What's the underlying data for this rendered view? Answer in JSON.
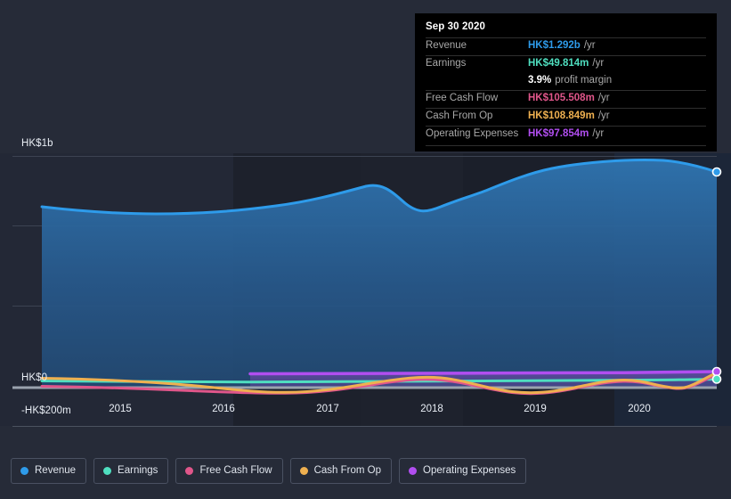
{
  "chart_data": {
    "type": "area",
    "title": "",
    "xlabel": "",
    "ylabel": "",
    "currency": "HK$",
    "grid": true,
    "legend_position": "bottom-left",
    "ylim": [
      -200000000,
      1100000000
    ],
    "y_ticks": [
      {
        "label": "HK$1b",
        "value": 1000000000
      },
      {
        "label": "HK$0",
        "value": 0
      },
      {
        "label": "-HK$200m",
        "value": -200000000
      }
    ],
    "x_ticks": [
      "2015",
      "2016",
      "2017",
      "2018",
      "2019",
      "2020"
    ],
    "xlim": [
      "2014-06",
      "2020-12"
    ],
    "series": [
      {
        "name": "Revenue",
        "color": "#2e9bea",
        "fill": true,
        "values": [
          {
            "x": "2014-09",
            "y": 740
          },
          {
            "x": "2015-03",
            "y": 716
          },
          {
            "x": "2015-09",
            "y": 706
          },
          {
            "x": "2016-03",
            "y": 708
          },
          {
            "x": "2016-09",
            "y": 730
          },
          {
            "x": "2017-03",
            "y": 776
          },
          {
            "x": "2017-06",
            "y": 794
          },
          {
            "x": "2017-12",
            "y": 712
          },
          {
            "x": "2018-06",
            "y": 760
          },
          {
            "x": "2018-12",
            "y": 880
          },
          {
            "x": "2019-06",
            "y": 962
          },
          {
            "x": "2019-12",
            "y": 1060
          },
          {
            "x": "2020-03",
            "y": 1115
          },
          {
            "x": "2020-09",
            "y": 1292
          }
        ]
      },
      {
        "name": "Earnings",
        "color": "#4fdfc0",
        "fill": false,
        "values": [
          {
            "x": "2014-09",
            "y": -13
          },
          {
            "x": "2015-09",
            "y": -14
          },
          {
            "x": "2016-09",
            "y": -12
          },
          {
            "x": "2017-09",
            "y": -10
          },
          {
            "x": "2018-09",
            "y": -8
          },
          {
            "x": "2019-09",
            "y": -6
          },
          {
            "x": "2020-09",
            "y": 49.814
          }
        ]
      },
      {
        "name": "Free Cash Flow",
        "color": "#e0568a",
        "fill": false,
        "values": [
          {
            "x": "2014-09",
            "y": -4
          },
          {
            "x": "2015-09",
            "y": -18
          },
          {
            "x": "2016-09",
            "y": -42
          },
          {
            "x": "2017-06",
            "y": -12
          },
          {
            "x": "2018-03",
            "y": -50
          },
          {
            "x": "2019-03",
            "y": -4
          },
          {
            "x": "2019-12",
            "y": -30
          },
          {
            "x": "2020-09",
            "y": 105.508
          }
        ]
      },
      {
        "name": "Cash From Op",
        "color": "#efb050",
        "fill": false,
        "values": [
          {
            "x": "2014-09",
            "y": 4
          },
          {
            "x": "2015-09",
            "y": -14
          },
          {
            "x": "2016-09",
            "y": -40
          },
          {
            "x": "2017-06",
            "y": -10
          },
          {
            "x": "2018-03",
            "y": -48
          },
          {
            "x": "2019-03",
            "y": -2
          },
          {
            "x": "2019-12",
            "y": -28
          },
          {
            "x": "2020-09",
            "y": 108.849
          }
        ]
      },
      {
        "name": "Operating Expenses",
        "color": "#b14ef0",
        "fill": true,
        "values": [
          {
            "x": "2016-06",
            "y": 46
          },
          {
            "x": "2017-06",
            "y": 50
          },
          {
            "x": "2018-06",
            "y": 54
          },
          {
            "x": "2019-06",
            "y": 62
          },
          {
            "x": "2020-09",
            "y": 97.854
          }
        ]
      }
    ]
  },
  "tooltip": {
    "date": "Sep 30 2020",
    "rows": [
      {
        "key": "Revenue",
        "value": "HK$1.292b",
        "unit": "/yr",
        "color": "#2e9bea"
      },
      {
        "key": "Earnings",
        "value": "HK$49.814m",
        "unit": "/yr",
        "color": "#4fdfc0"
      },
      {
        "key": "",
        "value": "3.9%",
        "unit": "profit margin",
        "color": "#ffffff"
      },
      {
        "key": "Free Cash Flow",
        "value": "HK$105.508m",
        "unit": "/yr",
        "color": "#e0568a"
      },
      {
        "key": "Cash From Op",
        "value": "HK$108.849m",
        "unit": "/yr",
        "color": "#efb050"
      },
      {
        "key": "Operating Expenses",
        "value": "HK$97.854m",
        "unit": "/yr",
        "color": "#b14ef0"
      }
    ]
  },
  "legend": {
    "items": [
      {
        "label": "Revenue",
        "color": "#2e9bea"
      },
      {
        "label": "Earnings",
        "color": "#4fdfc0"
      },
      {
        "label": "Free Cash Flow",
        "color": "#e0568a"
      },
      {
        "label": "Cash From Op",
        "color": "#efb050"
      },
      {
        "label": "Operating Expenses",
        "color": "#b14ef0"
      }
    ]
  },
  "axis": {
    "y_labels": [
      "HK$1b",
      "HK$0",
      "-HK$200m"
    ],
    "x_labels": [
      "2015",
      "2016",
      "2017",
      "2018",
      "2019",
      "2020"
    ]
  },
  "colors": {
    "background": "#262b38",
    "plot_background": "#232836",
    "plot_band_dark": "#1d212c",
    "plot_band_light": "#1b2433",
    "gridline": "#3c4352",
    "zero_axis": "#9aa2ae",
    "tooltip_background": "#000000",
    "tooltip_rule": "#2e2e2e",
    "text": "#e9eef5",
    "muted_text": "#a8a8a8",
    "legend_border": "#4a5162"
  }
}
